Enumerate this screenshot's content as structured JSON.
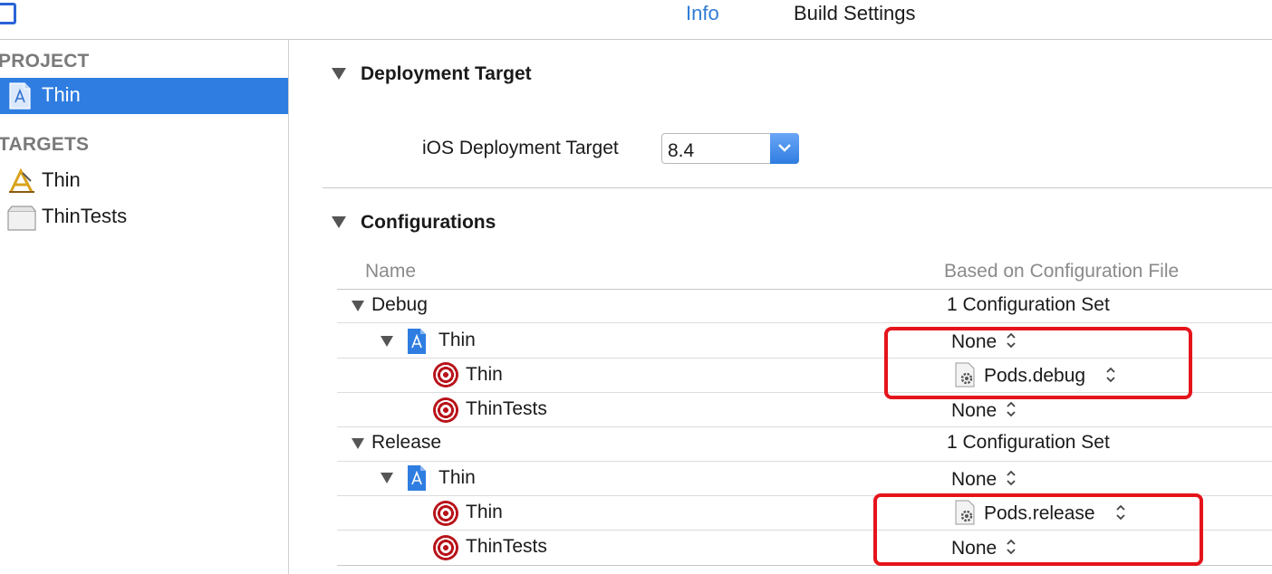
{
  "tabs": {
    "info": "Info",
    "build_settings": "Build Settings"
  },
  "sidebar": {
    "project_header": "PROJECT",
    "project_item": "Thin",
    "targets_header": "TARGETS",
    "targets": [
      "Thin",
      "ThinTests"
    ]
  },
  "deployment": {
    "section_title": "Deployment Target",
    "label": "iOS Deployment Target",
    "value": "8.4"
  },
  "configurations": {
    "section_title": "Configurations",
    "col_name": "Name",
    "col_based_on": "Based on Configuration File",
    "debug": {
      "name": "Debug",
      "summary": "1 Configuration Set",
      "project_name": "Thin",
      "project_value": "None",
      "target_thin": "Thin",
      "target_thin_value": "Pods.debug",
      "target_tests": "ThinTests",
      "target_tests_value": "None"
    },
    "release": {
      "name": "Release",
      "summary": "1 Configuration Set",
      "project_name": "Thin",
      "project_value": "None",
      "target_thin": "Thin",
      "target_thin_value": "Pods.release",
      "target_tests": "ThinTests",
      "target_tests_value": "None"
    }
  },
  "colors": {
    "accent": "#2f7de1",
    "highlight": "#e5141b",
    "target_red": "#b8131a"
  }
}
